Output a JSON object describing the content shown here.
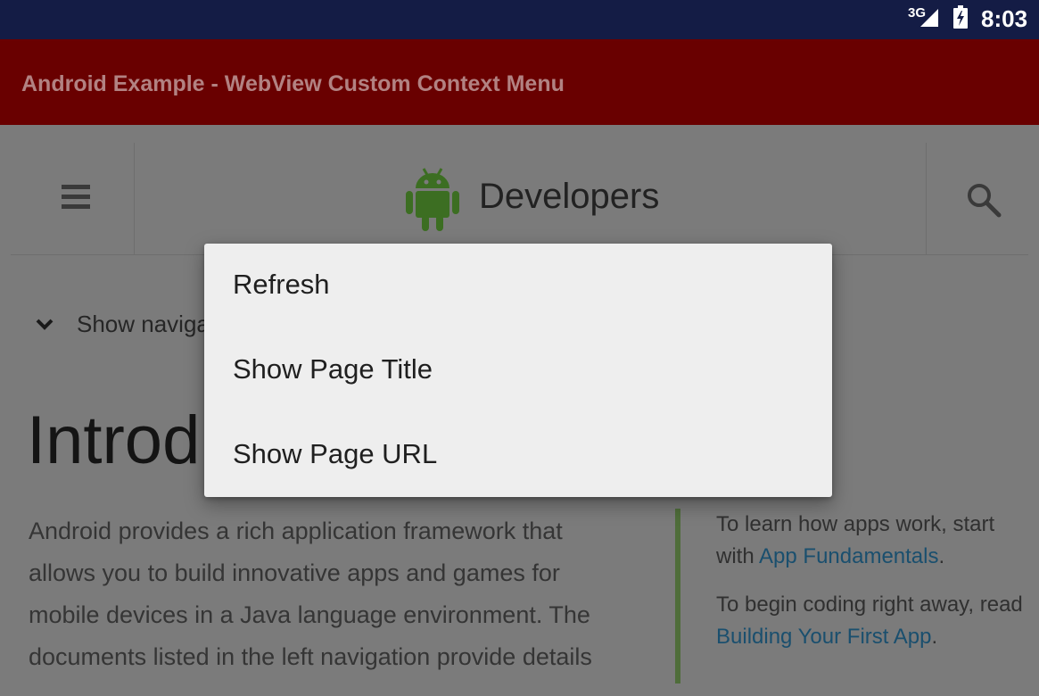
{
  "status_bar": {
    "network_type": "3G",
    "time": "8:03",
    "signal_icon": "cellular-signal-icon",
    "battery_icon": "battery-charging-icon"
  },
  "app_bar": {
    "title": "Android Example - WebView Custom Context Menu"
  },
  "webview": {
    "header": {
      "menu_icon": "hamburger-icon",
      "logo_icon": "android-robot-icon",
      "brand": "Developers",
      "search_icon": "search-icon"
    },
    "nav_toggle_label": "Show navigation",
    "heading": "Introduction to Android",
    "intro_lines": [
      "Android provides a rich application framework that",
      "allows you to build innovative apps and games for",
      "mobile devices in a Java language environment. The",
      "documents listed in the left navigation provide details"
    ],
    "callout": {
      "p1_prefix": "To learn how apps work, start with ",
      "p1_link": "App Fundamentals",
      "p1_suffix": ".",
      "p2_prefix": "To begin coding right away, read ",
      "p2_link": "Building Your First App",
      "p2_suffix": "."
    }
  },
  "context_menu": {
    "items": [
      {
        "label": "Refresh"
      },
      {
        "label": "Show Page Title"
      },
      {
        "label": "Show Page URL"
      }
    ]
  },
  "colors": {
    "status_bar": "#141c45",
    "app_bar": "#690000",
    "menu_background": "#eeeeee",
    "android_green": "#3c6e22",
    "callout_bar": "#4f6d3a"
  }
}
